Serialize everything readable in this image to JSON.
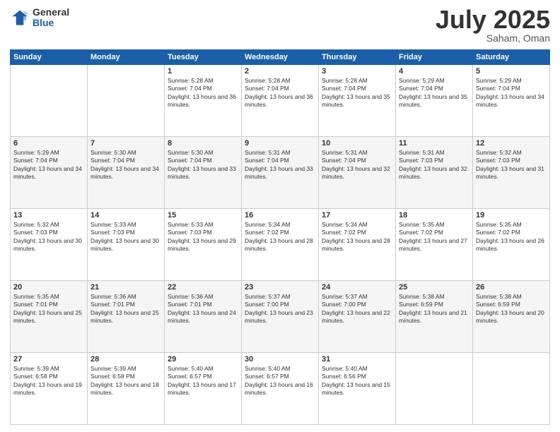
{
  "logo": {
    "general": "General",
    "blue": "Blue"
  },
  "header": {
    "month": "July 2025",
    "location": "Saham, Oman"
  },
  "weekdays": [
    "Sunday",
    "Monday",
    "Tuesday",
    "Wednesday",
    "Thursday",
    "Friday",
    "Saturday"
  ],
  "weeks": [
    [
      {
        "day": "",
        "info": ""
      },
      {
        "day": "",
        "info": ""
      },
      {
        "day": "1",
        "info": "Sunrise: 5:28 AM\nSunset: 7:04 PM\nDaylight: 13 hours and 36 minutes."
      },
      {
        "day": "2",
        "info": "Sunrise: 5:28 AM\nSunset: 7:04 PM\nDaylight: 13 hours and 36 minutes."
      },
      {
        "day": "3",
        "info": "Sunrise: 5:28 AM\nSunset: 7:04 PM\nDaylight: 13 hours and 35 minutes."
      },
      {
        "day": "4",
        "info": "Sunrise: 5:29 AM\nSunset: 7:04 PM\nDaylight: 13 hours and 35 minutes."
      },
      {
        "day": "5",
        "info": "Sunrise: 5:29 AM\nSunset: 7:04 PM\nDaylight: 13 hours and 34 minutes."
      }
    ],
    [
      {
        "day": "6",
        "info": "Sunrise: 5:29 AM\nSunset: 7:04 PM\nDaylight: 13 hours and 34 minutes."
      },
      {
        "day": "7",
        "info": "Sunrise: 5:30 AM\nSunset: 7:04 PM\nDaylight: 13 hours and 34 minutes."
      },
      {
        "day": "8",
        "info": "Sunrise: 5:30 AM\nSunset: 7:04 PM\nDaylight: 13 hours and 33 minutes."
      },
      {
        "day": "9",
        "info": "Sunrise: 5:31 AM\nSunset: 7:04 PM\nDaylight: 13 hours and 33 minutes."
      },
      {
        "day": "10",
        "info": "Sunrise: 5:31 AM\nSunset: 7:04 PM\nDaylight: 13 hours and 32 minutes."
      },
      {
        "day": "11",
        "info": "Sunrise: 5:31 AM\nSunset: 7:03 PM\nDaylight: 13 hours and 32 minutes."
      },
      {
        "day": "12",
        "info": "Sunrise: 5:32 AM\nSunset: 7:03 PM\nDaylight: 13 hours and 31 minutes."
      }
    ],
    [
      {
        "day": "13",
        "info": "Sunrise: 5:32 AM\nSunset: 7:03 PM\nDaylight: 13 hours and 30 minutes."
      },
      {
        "day": "14",
        "info": "Sunrise: 5:33 AM\nSunset: 7:03 PM\nDaylight: 13 hours and 30 minutes."
      },
      {
        "day": "15",
        "info": "Sunrise: 5:33 AM\nSunset: 7:03 PM\nDaylight: 13 hours and 29 minutes."
      },
      {
        "day": "16",
        "info": "Sunrise: 5:34 AM\nSunset: 7:02 PM\nDaylight: 13 hours and 28 minutes."
      },
      {
        "day": "17",
        "info": "Sunrise: 5:34 AM\nSunset: 7:02 PM\nDaylight: 13 hours and 28 minutes."
      },
      {
        "day": "18",
        "info": "Sunrise: 5:35 AM\nSunset: 7:02 PM\nDaylight: 13 hours and 27 minutes."
      },
      {
        "day": "19",
        "info": "Sunrise: 5:35 AM\nSunset: 7:02 PM\nDaylight: 13 hours and 26 minutes."
      }
    ],
    [
      {
        "day": "20",
        "info": "Sunrise: 5:35 AM\nSunset: 7:01 PM\nDaylight: 13 hours and 25 minutes."
      },
      {
        "day": "21",
        "info": "Sunrise: 5:36 AM\nSunset: 7:01 PM\nDaylight: 13 hours and 25 minutes."
      },
      {
        "day": "22",
        "info": "Sunrise: 5:36 AM\nSunset: 7:01 PM\nDaylight: 13 hours and 24 minutes."
      },
      {
        "day": "23",
        "info": "Sunrise: 5:37 AM\nSunset: 7:00 PM\nDaylight: 13 hours and 23 minutes."
      },
      {
        "day": "24",
        "info": "Sunrise: 5:37 AM\nSunset: 7:00 PM\nDaylight: 13 hours and 22 minutes."
      },
      {
        "day": "25",
        "info": "Sunrise: 5:38 AM\nSunset: 6:59 PM\nDaylight: 13 hours and 21 minutes."
      },
      {
        "day": "26",
        "info": "Sunrise: 5:38 AM\nSunset: 6:59 PM\nDaylight: 13 hours and 20 minutes."
      }
    ],
    [
      {
        "day": "27",
        "info": "Sunrise: 5:39 AM\nSunset: 6:58 PM\nDaylight: 13 hours and 19 minutes."
      },
      {
        "day": "28",
        "info": "Sunrise: 5:39 AM\nSunset: 6:58 PM\nDaylight: 13 hours and 18 minutes."
      },
      {
        "day": "29",
        "info": "Sunrise: 5:40 AM\nSunset: 6:57 PM\nDaylight: 13 hours and 17 minutes."
      },
      {
        "day": "30",
        "info": "Sunrise: 5:40 AM\nSunset: 6:57 PM\nDaylight: 13 hours and 16 minutes."
      },
      {
        "day": "31",
        "info": "Sunrise: 5:40 AM\nSunset: 6:56 PM\nDaylight: 13 hours and 15 minutes."
      },
      {
        "day": "",
        "info": ""
      },
      {
        "day": "",
        "info": ""
      }
    ]
  ]
}
